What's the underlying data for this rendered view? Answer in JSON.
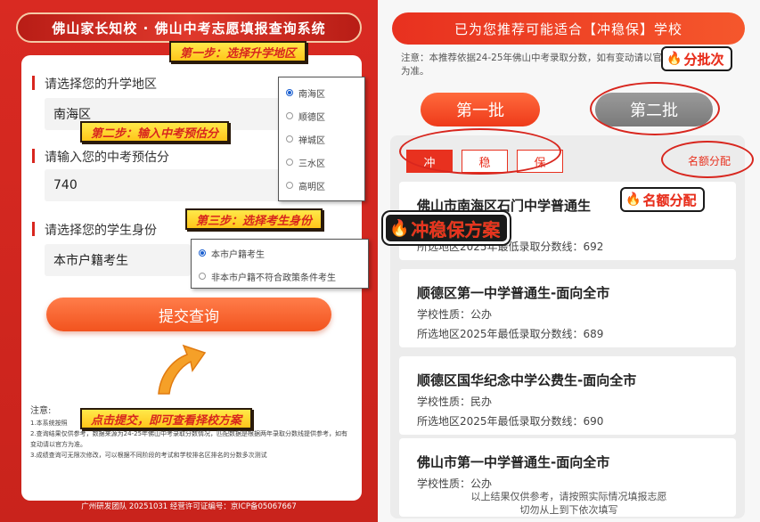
{
  "left": {
    "title": "佛山家长知校 · 佛山中考志愿填报查询系统",
    "step1": "第一步：选择升学地区",
    "step2": "第二步：输入中考预估分",
    "step3": "第三步：选择考生身份",
    "step_submit": "点击提交，即可查看择校方案",
    "region_label": "请选择您的升学地区",
    "region_value": "南海区",
    "score_label": "请输入您的中考预估分",
    "score_value": "740",
    "identity_label": "请选择您的学生身份",
    "identity_value": "本市户籍考生",
    "submit_label": "提交查询",
    "region_options": [
      {
        "label": "南海区",
        "selected": true
      },
      {
        "label": "顺德区",
        "selected": false
      },
      {
        "label": "禅城区",
        "selected": false
      },
      {
        "label": "三水区",
        "selected": false
      },
      {
        "label": "高明区",
        "selected": false
      }
    ],
    "identity_options": [
      {
        "label": "本市户籍考生",
        "selected": true
      },
      {
        "label": "非本市户籍不符合政策条件考生",
        "selected": false
      }
    ],
    "notes_title": "注意:",
    "notes": [
      "1.本系统按照",
      "2.查询结果仅供参考，数据来源为24-25年佛山中考录取分数情况，匹配数据是根据两年录取分数线提供参考，如有变动请以官方为准。",
      "3.成绩查询可无限次修改，可以根据不同阶段的考试和学校排名区排名的分数多次测试"
    ],
    "footer": "广州研发团队 20251031 经营许可证编号：京ICP备05067667"
  },
  "right": {
    "banner": "已为您推荐可能适合【冲稳保】学校",
    "note": "注意：本推荐依据24-25年佛山中考录取分数，如有变动请以官方公布为准。",
    "tag_batch": "分批次",
    "batch1": "第一批",
    "batch2": "第二批",
    "filter_tabs": [
      "冲",
      "稳",
      "保"
    ],
    "quota_link": "名额分配",
    "tag_quota": "名额分配",
    "tag_plan": "冲稳保方案",
    "schools": [
      {
        "name": "佛山市南海区石门中学普通生",
        "line1": "",
        "line2": "所选地区2025年最低录取分数线：692"
      },
      {
        "name": "顺德区第一中学普通生-面向全市",
        "line1": "学校性质：公办",
        "line2": "所选地区2025年最低录取分数线：689"
      },
      {
        "name": "顺德区国华纪念中学公费生-面向全市",
        "line1": "学校性质：民办",
        "line2": "所选地区2025年最低录取分数线：690"
      },
      {
        "name": "佛山市第一中学普通生-面向全市",
        "line1": "学校性质：公办",
        "line2": ""
      }
    ],
    "bottom_note_1": "以上结果仅供参考，请按照实际情况填报志愿",
    "bottom_note_2": "切勿从上到下依次填写"
  },
  "colors": {
    "primary_red": "#d8261e",
    "accent_orange": "#f2531e",
    "highlight_yellow": "#ffc51a"
  },
  "icons": {
    "fire": "fire-icon",
    "arrow": "curved-arrow-icon"
  }
}
